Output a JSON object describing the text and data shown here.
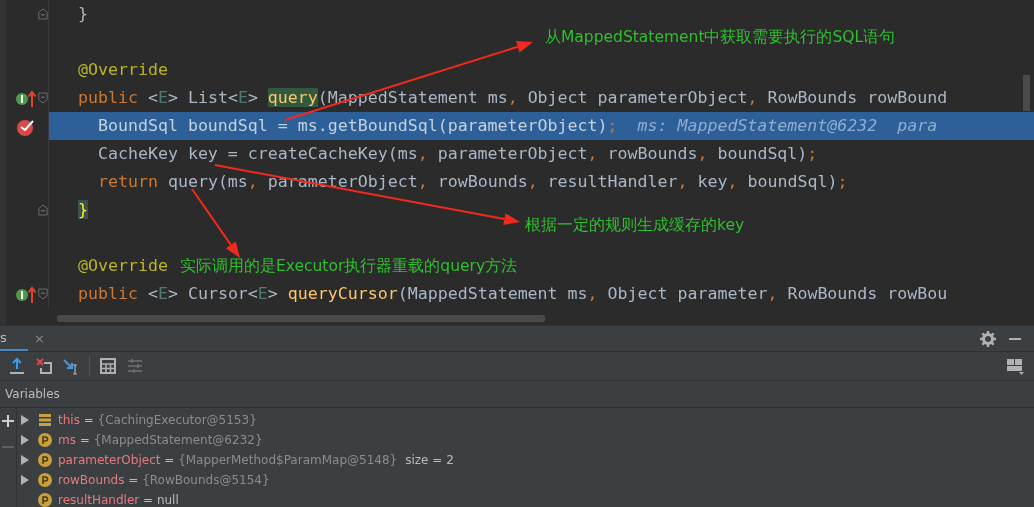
{
  "editor": {
    "lines": [
      {
        "current": false,
        "fold": {
          "kind": "end"
        },
        "segments": [
          {
            "text": "}",
            "kind": "plain"
          }
        ]
      },
      {
        "current": false
      },
      {
        "current": false,
        "segments": [
          {
            "text": "@Override",
            "kind": "annotation"
          }
        ]
      },
      {
        "current": false,
        "gutter_icon": {
          "kind": "override"
        },
        "fold": {
          "kind": "start"
        },
        "segments": [
          {
            "text": "public",
            "kind": "keyword"
          },
          {
            "text": " <",
            "kind": "plain"
          },
          {
            "text": "E",
            "kind": "type_param"
          },
          {
            "text": "> List<",
            "kind": "plain"
          },
          {
            "text": "E",
            "kind": "type_param"
          },
          {
            "text": "> ",
            "kind": "plain"
          },
          {
            "text": "query",
            "kind": "match"
          },
          {
            "text": "(MappedStatement ms",
            "kind": "plain"
          },
          {
            "text": ",",
            "kind": "punct"
          },
          {
            "text": " Object parameterObject",
            "kind": "plain"
          },
          {
            "text": ",",
            "kind": "punct"
          },
          {
            "text": " RowBounds rowBound",
            "kind": "plain"
          }
        ]
      },
      {
        "current": true,
        "gutter_icon": {
          "kind": "breakpoint"
        },
        "segments": [
          {
            "text": "  BoundSql boundSql = ms.getBoundSql(parameterObject)",
            "kind": "plain"
          },
          {
            "text": ";",
            "kind": "punct"
          },
          {
            "text": "  ms: MappedStatement@6232  para",
            "kind": "hint"
          }
        ]
      },
      {
        "current": false,
        "segments": [
          {
            "text": "  CacheKey key = createCacheKey(ms",
            "kind": "plain"
          },
          {
            "text": ",",
            "kind": "punct"
          },
          {
            "text": " parameterObject",
            "kind": "plain"
          },
          {
            "text": ",",
            "kind": "punct"
          },
          {
            "text": " rowBounds",
            "kind": "plain"
          },
          {
            "text": ",",
            "kind": "punct"
          },
          {
            "text": " boundSql)",
            "kind": "plain"
          },
          {
            "text": ";",
            "kind": "punct"
          }
        ]
      },
      {
        "current": false,
        "segments": [
          {
            "text": "  return",
            "kind": "keyword"
          },
          {
            "text": " query(ms",
            "kind": "plain"
          },
          {
            "text": ",",
            "kind": "punct"
          },
          {
            "text": " parameterObject",
            "kind": "plain"
          },
          {
            "text": ",",
            "kind": "punct"
          },
          {
            "text": " rowBounds",
            "kind": "plain"
          },
          {
            "text": ",",
            "kind": "punct"
          },
          {
            "text": " resultHandler",
            "kind": "plain"
          },
          {
            "text": ",",
            "kind": "punct"
          },
          {
            "text": " key",
            "kind": "plain"
          },
          {
            "text": ",",
            "kind": "punct"
          },
          {
            "text": " boundSql)",
            "kind": "plain"
          },
          {
            "text": ";",
            "kind": "punct"
          }
        ]
      },
      {
        "current": false,
        "fold": {
          "kind": "end"
        },
        "segments": [
          {
            "text": "}",
            "kind": "brace_match"
          }
        ]
      },
      {
        "current": false
      },
      {
        "current": false,
        "segments": [
          {
            "text": "@Override",
            "kind": "annotation"
          }
        ]
      },
      {
        "current": false,
        "gutter_icon": {
          "kind": "override"
        },
        "fold": {
          "kind": "start"
        },
        "segments": [
          {
            "text": "public",
            "kind": "keyword"
          },
          {
            "text": " <",
            "kind": "plain"
          },
          {
            "text": "E",
            "kind": "type_param"
          },
          {
            "text": "> Cursor<",
            "kind": "plain"
          },
          {
            "text": "E",
            "kind": "type_param"
          },
          {
            "text": "> ",
            "kind": "plain"
          },
          {
            "text": "queryCursor",
            "kind": "method"
          },
          {
            "text": "(MappedStatement ms",
            "kind": "plain"
          },
          {
            "text": ",",
            "kind": "punct"
          },
          {
            "text": " Object parameter",
            "kind": "plain"
          },
          {
            "text": ",",
            "kind": "punct"
          },
          {
            "text": " RowBounds rowBou",
            "kind": "plain"
          }
        ]
      }
    ]
  },
  "annotations": [
    {
      "text": "从MappedStatement中获取需要执行的SQL语句"
    },
    {
      "text": "根据一定的规则生成缓存的key"
    },
    {
      "text": "实际调用的是Executor执行器重载的query方法"
    }
  ],
  "debug_panel": {
    "tab": {
      "label": "s",
      "close": "×"
    },
    "variables_header": "Variables",
    "variables": [
      {
        "kind": "field",
        "expandable": true,
        "name": "this",
        "equals": "=",
        "value": {
          "text": "{CachingExecutor@5153}",
          "kind": "object"
        }
      },
      {
        "kind": "param",
        "expandable": true,
        "name": "ms",
        "equals": "=",
        "value": {
          "text": "{MappedStatement@6232}",
          "kind": "object"
        }
      },
      {
        "kind": "param",
        "expandable": true,
        "name": "parameterObject",
        "equals": "=",
        "value": {
          "text": "{MapperMethod$ParamMap@5148}",
          "kind": "object"
        },
        "extra": "size = 2"
      },
      {
        "kind": "param",
        "expandable": true,
        "name": "rowBounds",
        "equals": "=",
        "value": {
          "text": "{RowBounds@5154}",
          "kind": "object"
        }
      },
      {
        "kind": "param",
        "expandable": false,
        "name": "resultHandler",
        "equals": "=",
        "value": {
          "text": "null",
          "kind": "plain"
        }
      }
    ]
  }
}
